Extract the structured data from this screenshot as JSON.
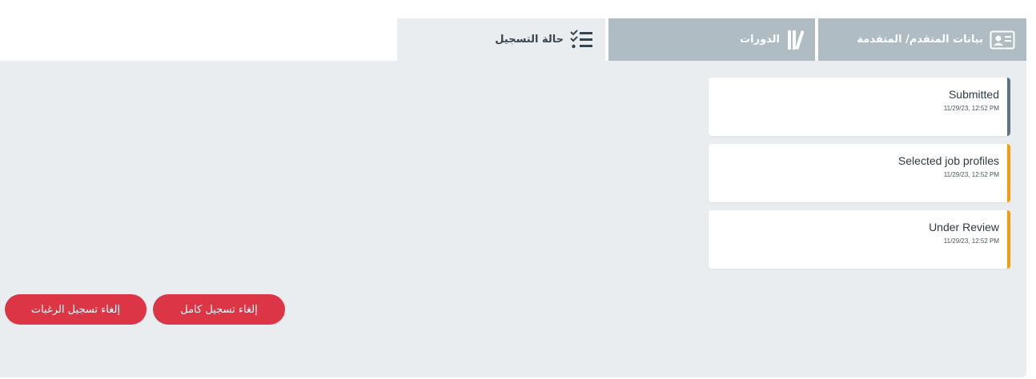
{
  "tabs": [
    {
      "label": "بيانات المتقدم/ المتقدمة",
      "icon": "id-card-icon",
      "active": false
    },
    {
      "label": "الدورات",
      "icon": "books-icon",
      "active": false
    },
    {
      "label": "حالة التسجيل",
      "icon": "checklist-icon",
      "active": true
    }
  ],
  "status_cards": [
    {
      "title": "Submitted",
      "date": "11/29/23, 12:52 PM",
      "accent": "#5f7482"
    },
    {
      "title": "Selected job profiles",
      "date": "11/29/23, 12:52 PM",
      "accent": "#f39c12"
    },
    {
      "title": "Under Review",
      "date": "11/29/23, 12:52 PM",
      "accent": "#f39c12"
    }
  ],
  "actions": {
    "cancel_full": "إلغاء تسجيل كامل",
    "cancel_preferences": "إلغاء تسجيل الرغبات"
  },
  "colors": {
    "tab_inactive_bg": "#afbcc3",
    "panel_bg": "#e9edf0",
    "danger": "#dc3545"
  }
}
